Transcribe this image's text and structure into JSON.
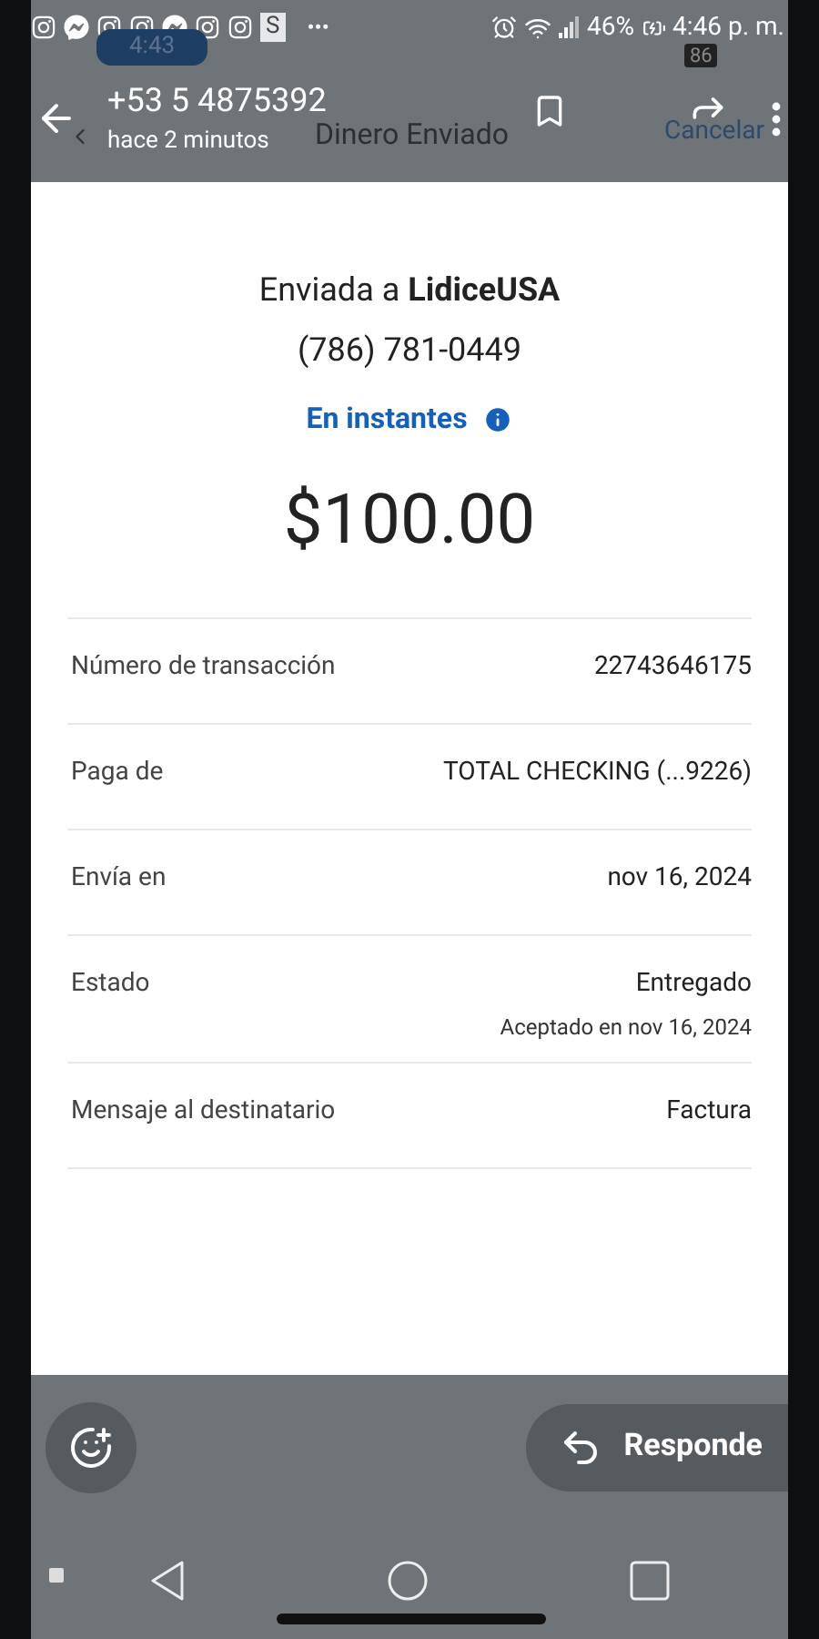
{
  "status_bar": {
    "notifications": [
      {
        "kind": "instagram"
      },
      {
        "kind": "messenger"
      },
      {
        "kind": "instagram"
      },
      {
        "kind": "instagram"
      },
      {
        "kind": "messenger"
      },
      {
        "kind": "instagram"
      },
      {
        "kind": "instagram"
      },
      {
        "kind": "letter",
        "text": "S"
      },
      {
        "kind": "more",
        "text": "•••"
      }
    ],
    "battery": "46%",
    "time": "4:46 p. m."
  },
  "behind": {
    "time": "4:43",
    "battery": "86",
    "title": "Dinero Enviado",
    "cancel": "Cancelar"
  },
  "header": {
    "contact": "+53 5 4875392",
    "subtitle": "hace 2 minutos"
  },
  "receipt": {
    "sent_to_prefix": "Enviada a",
    "recipient": "LidiceUSA",
    "phone": "(786) 781-0449",
    "speed": "En instantes",
    "amount": "$100.00",
    "rows": [
      {
        "label": "Número de transacción",
        "value": "22743646175"
      },
      {
        "label": "Paga de",
        "value": "TOTAL CHECKING (...9226)"
      },
      {
        "label": "Envía en",
        "value": "nov 16, 2024"
      },
      {
        "label": "Estado",
        "value": "Entregado",
        "note": "Aceptado en nov 16, 2024"
      },
      {
        "label": "Mensaje al destinatario",
        "value": "Factura"
      }
    ]
  },
  "reply_button": "Responde"
}
